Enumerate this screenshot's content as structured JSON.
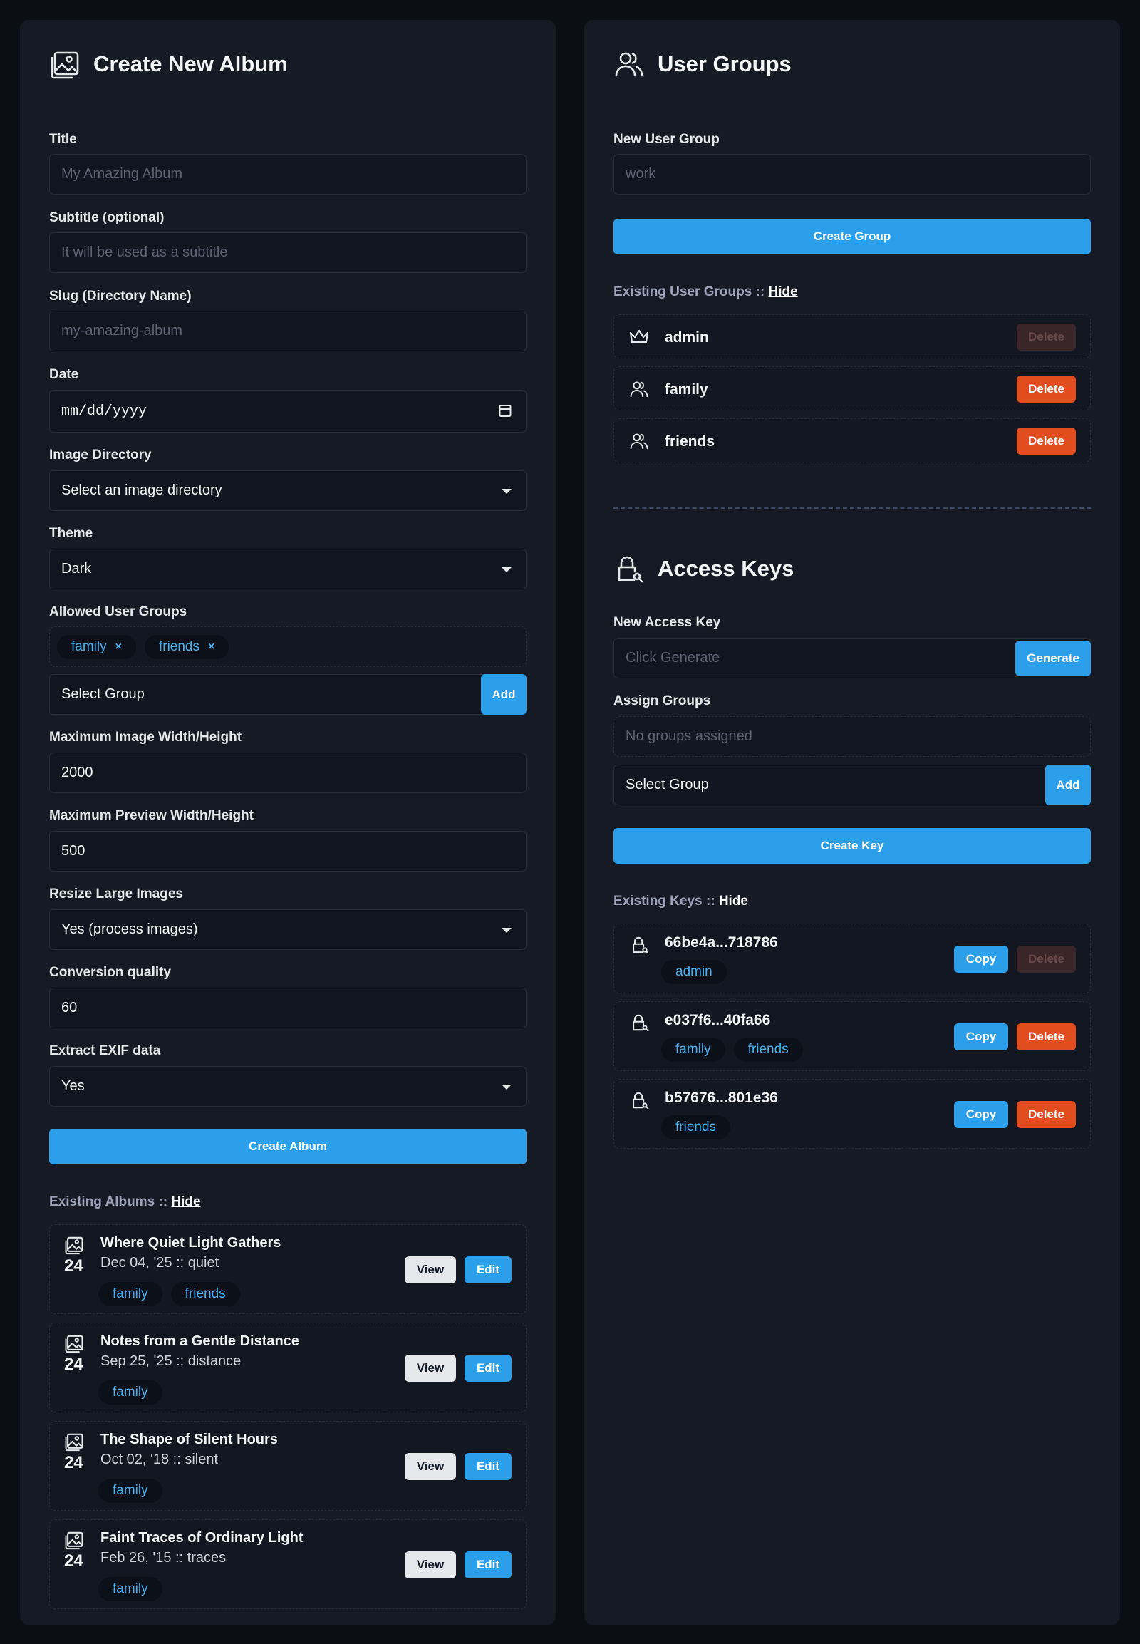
{
  "album_form": {
    "heading": "Create New Album",
    "title_label": "Title",
    "title_placeholder": "My Amazing Album",
    "subtitle_label": "Subtitle (optional)",
    "subtitle_placeholder": "It will be used as a subtitle",
    "slug_label": "Slug (Directory Name)",
    "slug_placeholder": "my-amazing-album",
    "date_label": "Date",
    "date_placeholder": "mm/dd/yyyy",
    "image_dir_label": "Image Directory",
    "image_dir_value": "Select an image directory",
    "theme_label": "Theme",
    "theme_value": "Dark",
    "allowed_groups_label": "Allowed User Groups",
    "allowed_groups": [
      "family",
      "friends"
    ],
    "select_group_value": "Select Group",
    "add_label": "Add",
    "max_image_label": "Maximum Image Width/Height",
    "max_image_value": "2000",
    "max_preview_label": "Maximum Preview Width/Height",
    "max_preview_value": "500",
    "resize_label": "Resize Large Images",
    "resize_value": "Yes (process images)",
    "quality_label": "Conversion quality",
    "quality_value": "60",
    "exif_label": "Extract EXIF data",
    "exif_value": "Yes",
    "create_label": "Create Album"
  },
  "existing_albums": {
    "label": "Existing Albums ::",
    "hide": "Hide",
    "view_label": "View",
    "edit_label": "Edit",
    "items": [
      {
        "count": "24",
        "title": "Where Quiet Light Gathers",
        "meta": "Dec 04, '25 :: quiet",
        "groups": [
          "family",
          "friends"
        ]
      },
      {
        "count": "24",
        "title": "Notes from a Gentle Distance",
        "meta": "Sep 25, '25 :: distance",
        "groups": [
          "family"
        ]
      },
      {
        "count": "24",
        "title": "The Shape of Silent Hours",
        "meta": "Oct 02, '18 :: silent",
        "groups": [
          "family"
        ]
      },
      {
        "count": "24",
        "title": "Faint Traces of Ordinary Light",
        "meta": "Feb 26, '15 :: traces",
        "groups": [
          "family"
        ]
      }
    ]
  },
  "user_groups": {
    "heading": "User Groups",
    "new_label": "New User Group",
    "new_placeholder": "work",
    "create_label": "Create Group",
    "existing_label": "Existing User Groups ::",
    "hide": "Hide",
    "delete_label": "Delete",
    "items": [
      {
        "name": "admin",
        "icon": "crown-icon",
        "deletable": false
      },
      {
        "name": "family",
        "icon": "users-icon",
        "deletable": true
      },
      {
        "name": "friends",
        "icon": "users-icon",
        "deletable": true
      }
    ]
  },
  "access_keys": {
    "heading": "Access Keys",
    "new_label": "New Access Key",
    "new_placeholder": "Click Generate",
    "generate_label": "Generate",
    "assign_label": "Assign Groups",
    "assign_placeholder": "No groups assigned",
    "select_group_value": "Select Group",
    "add_label": "Add",
    "create_label": "Create Key",
    "existing_label": "Existing Keys ::",
    "hide": "Hide",
    "copy_label": "Copy",
    "delete_label": "Delete",
    "items": [
      {
        "key": "66be4a...718786",
        "groups": [
          "admin"
        ],
        "deletable": false
      },
      {
        "key": "e037f6...40fa66",
        "groups": [
          "family",
          "friends"
        ],
        "deletable": true
      },
      {
        "key": "b57676...801e36",
        "groups": [
          "friends"
        ],
        "deletable": true
      }
    ]
  },
  "colors": {
    "accent": "#2b9fea",
    "danger": "#e14d1f",
    "panel": "#151a24",
    "background": "#0b0e14"
  }
}
